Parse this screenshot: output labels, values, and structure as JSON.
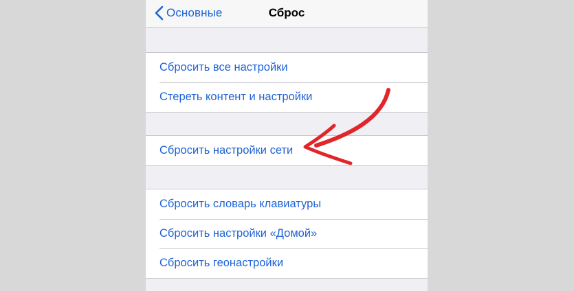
{
  "navbar": {
    "back_label": "Основные",
    "title": "Сброс"
  },
  "groups": [
    {
      "items": [
        {
          "label": "Сбросить все настройки"
        },
        {
          "label": "Стереть контент и настройки"
        }
      ]
    },
    {
      "items": [
        {
          "label": "Сбросить настройки сети"
        }
      ]
    },
    {
      "items": [
        {
          "label": "Сбросить словарь клавиатуры"
        },
        {
          "label": "Сбросить настройки «Домой»"
        },
        {
          "label": "Сбросить геонастройки"
        }
      ]
    }
  ],
  "colors": {
    "accent": "#1d62d6",
    "background": "#efeff4",
    "annotation_arrow": "#e0262b"
  },
  "icons": {
    "back": "chevron-left-icon",
    "annotation": "red-arrow-annotation"
  }
}
